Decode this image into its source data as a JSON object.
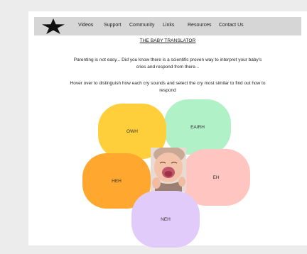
{
  "nav": {
    "logo_icon": "star-icon",
    "items": [
      "Videos",
      "Support",
      "Community",
      "Links",
      "Resources",
      "Contact Us"
    ]
  },
  "content": {
    "title": "THE BABY TRANSLATOR",
    "intro": "Parenting is not easy... Did you know there is a scientific proven way to interpret your baby's cries and respond from there...",
    "instruction": "Hover over to distinguish how each cry sounds and select the cry most similar to find out how to respond"
  },
  "cries": [
    {
      "label": "OWH",
      "color": "#ffcf3b"
    },
    {
      "label": "EAIRH",
      "color": "#b0f1c8"
    },
    {
      "label": "HEH",
      "color": "#ffa72e"
    },
    {
      "label": "EH",
      "color": "#ffc5c0"
    },
    {
      "label": "NEH",
      "color": "#e0cbfb"
    }
  ],
  "colors": {
    "navbar": "#d6d6d6",
    "page_bg": "#ffffff",
    "outer_bg": "#ececec"
  }
}
